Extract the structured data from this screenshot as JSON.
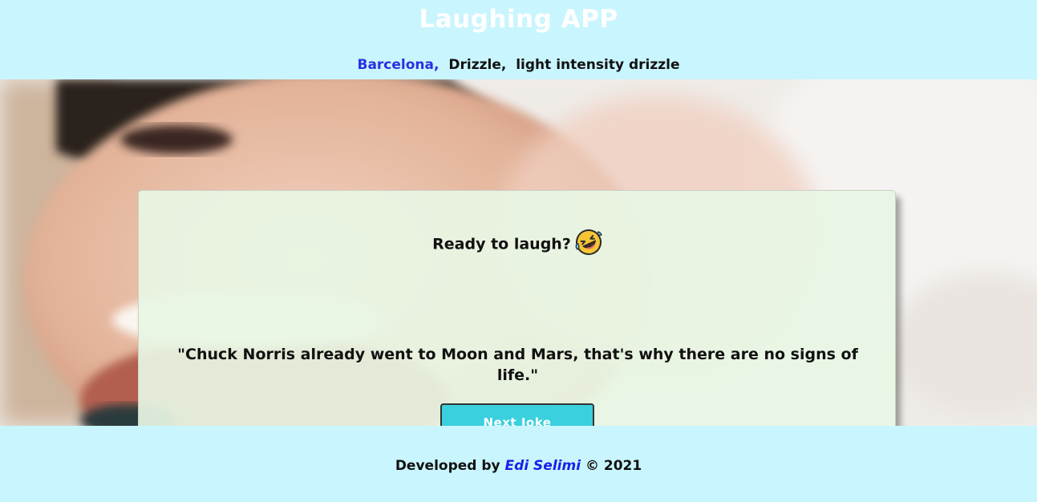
{
  "header": {
    "title": "Laughing APP",
    "weather": {
      "city": "Barcelona,",
      "condition": "Drizzle,",
      "description": "light intensity drizzle"
    }
  },
  "card": {
    "heading": "Ready to laugh?",
    "heading_icon": "rolling-on-floor-laughing-emoji",
    "joke": "\"Chuck Norris already went to Moon and Mars, that's why there are no signs of life.\"",
    "button_label": "Next Joke"
  },
  "footer": {
    "prefix": "Developed by",
    "author": "Edi Selimi",
    "suffix": "© 2021"
  },
  "colors": {
    "page_background": "#c9f5fe",
    "title": "#ffffff",
    "city": "#2930e0",
    "card_background": "#e8f6e4",
    "button": "#3bd0dd",
    "author_link": "#1a20e8"
  }
}
